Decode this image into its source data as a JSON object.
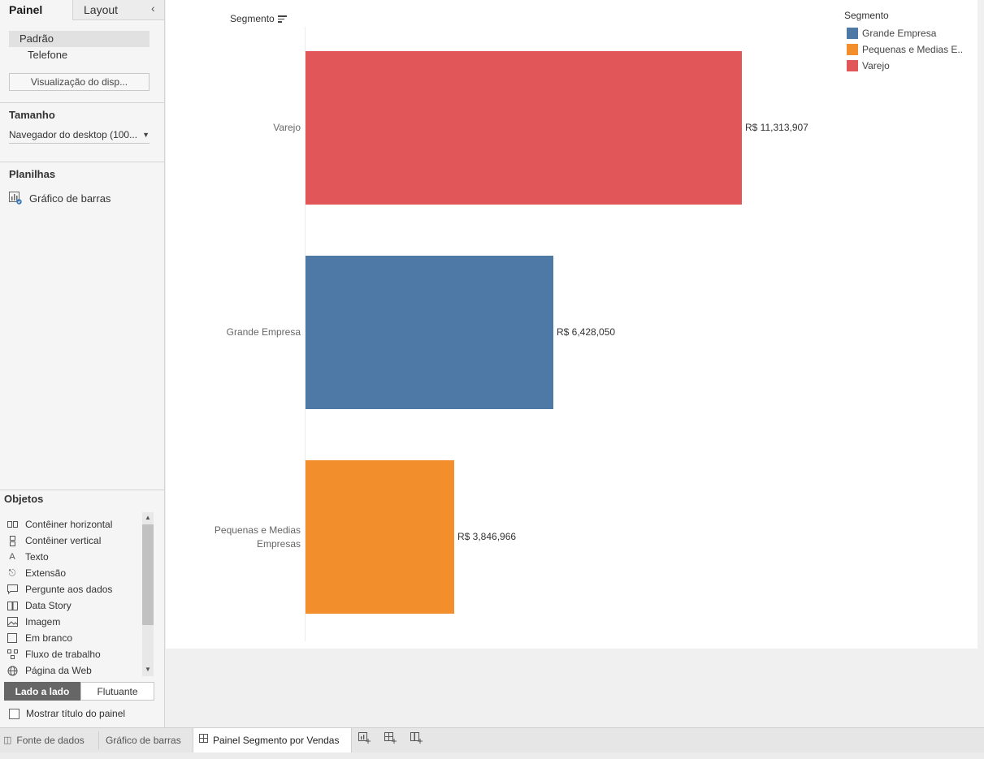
{
  "sidebar": {
    "tabs": [
      "Painel",
      "Layout"
    ],
    "devices": [
      "Padrão",
      "Telefone"
    ],
    "preview_button": "Visualização do disp...",
    "size_title": "Tamanho",
    "size_value": "Navegador do desktop (100...",
    "sheets_title": "Planilhas",
    "sheets": [
      "Gráfico de barras"
    ],
    "objects_title": "Objetos",
    "objects": [
      {
        "label": "Contêiner horizontal",
        "icon": "horizontal-container-icon"
      },
      {
        "label": "Contêiner vertical",
        "icon": "vertical-container-icon"
      },
      {
        "label": "Texto",
        "icon": "text-icon"
      },
      {
        "label": "Extensão",
        "icon": "extension-icon"
      },
      {
        "label": "Pergunte aos dados",
        "icon": "ask-data-icon"
      },
      {
        "label": "Data Story",
        "icon": "data-story-icon"
      },
      {
        "label": "Imagem",
        "icon": "image-icon"
      },
      {
        "label": "Em branco",
        "icon": "blank-icon"
      },
      {
        "label": "Fluxo de trabalho",
        "icon": "workflow-icon"
      },
      {
        "label": "Página da Web",
        "icon": "web-page-icon"
      }
    ],
    "layout_toggle": [
      "Lado a lado",
      "Flutuante"
    ],
    "show_title_label": "Mostrar título do painel",
    "show_title_checked": false
  },
  "chart_data": {
    "type": "bar",
    "orientation": "horizontal",
    "header": "Segmento",
    "categories": [
      "Varejo",
      "Grande Empresa",
      "Pequenas e Medias Empresas"
    ],
    "values": [
      11313907,
      6428050,
      3846966
    ],
    "value_labels": [
      "R$ 11,313,907",
      "R$ 6,428,050",
      "R$ 3,846,966"
    ],
    "colors": [
      "#e15759",
      "#4e79a7",
      "#f28e2b"
    ],
    "legend": {
      "title": "Segmento",
      "placement": "top-right",
      "items": [
        {
          "label": "Grande Empresa",
          "color": "#4e79a7"
        },
        {
          "label": "Pequenas e Medias E..",
          "color": "#f28e2b"
        },
        {
          "label": "Varejo",
          "color": "#e15759"
        }
      ]
    },
    "xlim": [
      0,
      11313907
    ],
    "grid": false
  },
  "bottom_tabs": {
    "datasource": "Fonte de dados",
    "sheet": "Gráfico de barras",
    "dashboard": "Painel Segmento por Vendas"
  }
}
